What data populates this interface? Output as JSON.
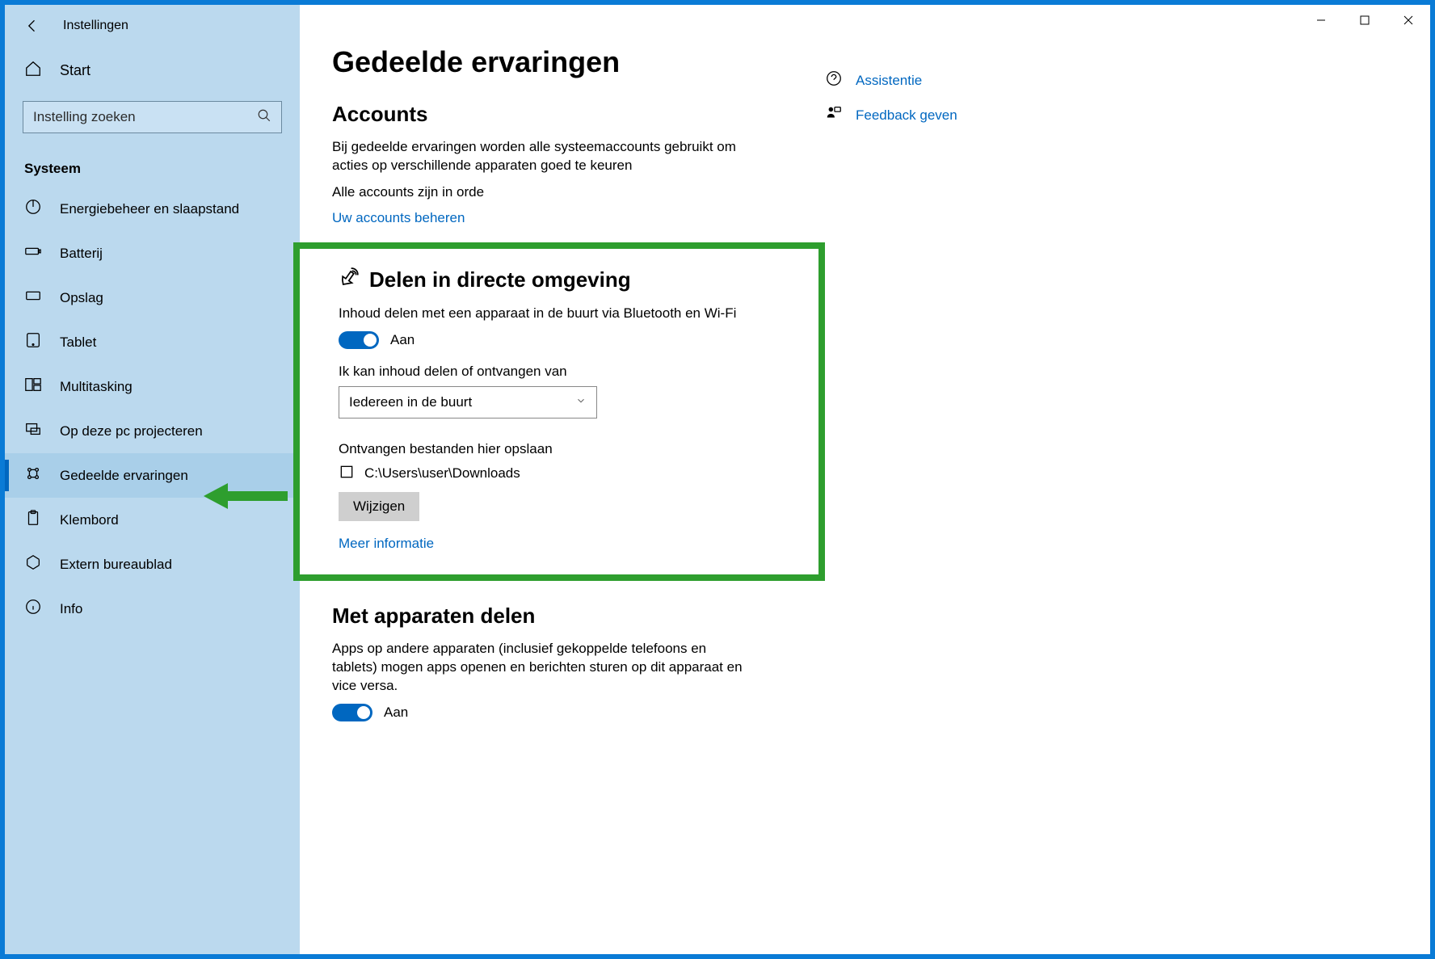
{
  "app_title": "Instellingen",
  "home_label": "Start",
  "search_placeholder": "Instelling zoeken",
  "category": "Systeem",
  "nav_items": [
    {
      "id": "power",
      "label": "Energiebeheer en slaapstand"
    },
    {
      "id": "battery",
      "label": "Batterij"
    },
    {
      "id": "storage",
      "label": "Opslag"
    },
    {
      "id": "tablet",
      "label": "Tablet"
    },
    {
      "id": "multitask",
      "label": "Multitasking"
    },
    {
      "id": "project",
      "label": "Op deze pc projecteren"
    },
    {
      "id": "shared",
      "label": "Gedeelde ervaringen",
      "active": true
    },
    {
      "id": "clipboard",
      "label": "Klembord"
    },
    {
      "id": "remote",
      "label": "Extern bureaublad"
    },
    {
      "id": "about",
      "label": "Info"
    }
  ],
  "page_title": "Gedeelde ervaringen",
  "accounts": {
    "title": "Accounts",
    "desc": "Bij gedeelde ervaringen worden alle systeemaccounts gebruikt om acties op verschillende apparaten goed te keuren",
    "status": "Alle accounts zijn in orde",
    "manage_link": "Uw accounts beheren"
  },
  "nearby": {
    "title": "Delen in directe omgeving",
    "desc": "Inhoud delen met een apparaat in de buurt via Bluetooth en Wi-Fi",
    "toggle_label": "Aan",
    "receive_label": "Ik kan inhoud delen of ontvangen van",
    "receive_value": "Iedereen in de buurt",
    "save_label": "Ontvangen bestanden hier opslaan",
    "save_path": "C:\\Users\\user\\Downloads",
    "change_btn": "Wijzigen",
    "more_info": "Meer informatie"
  },
  "share_devices": {
    "title": "Met apparaten delen",
    "desc": "Apps op andere apparaten (inclusief gekoppelde telefoons en tablets) mogen apps openen en berichten sturen op dit apparaat en vice versa.",
    "toggle_label": "Aan"
  },
  "side_links": {
    "help": "Assistentie",
    "feedback": "Feedback geven"
  }
}
